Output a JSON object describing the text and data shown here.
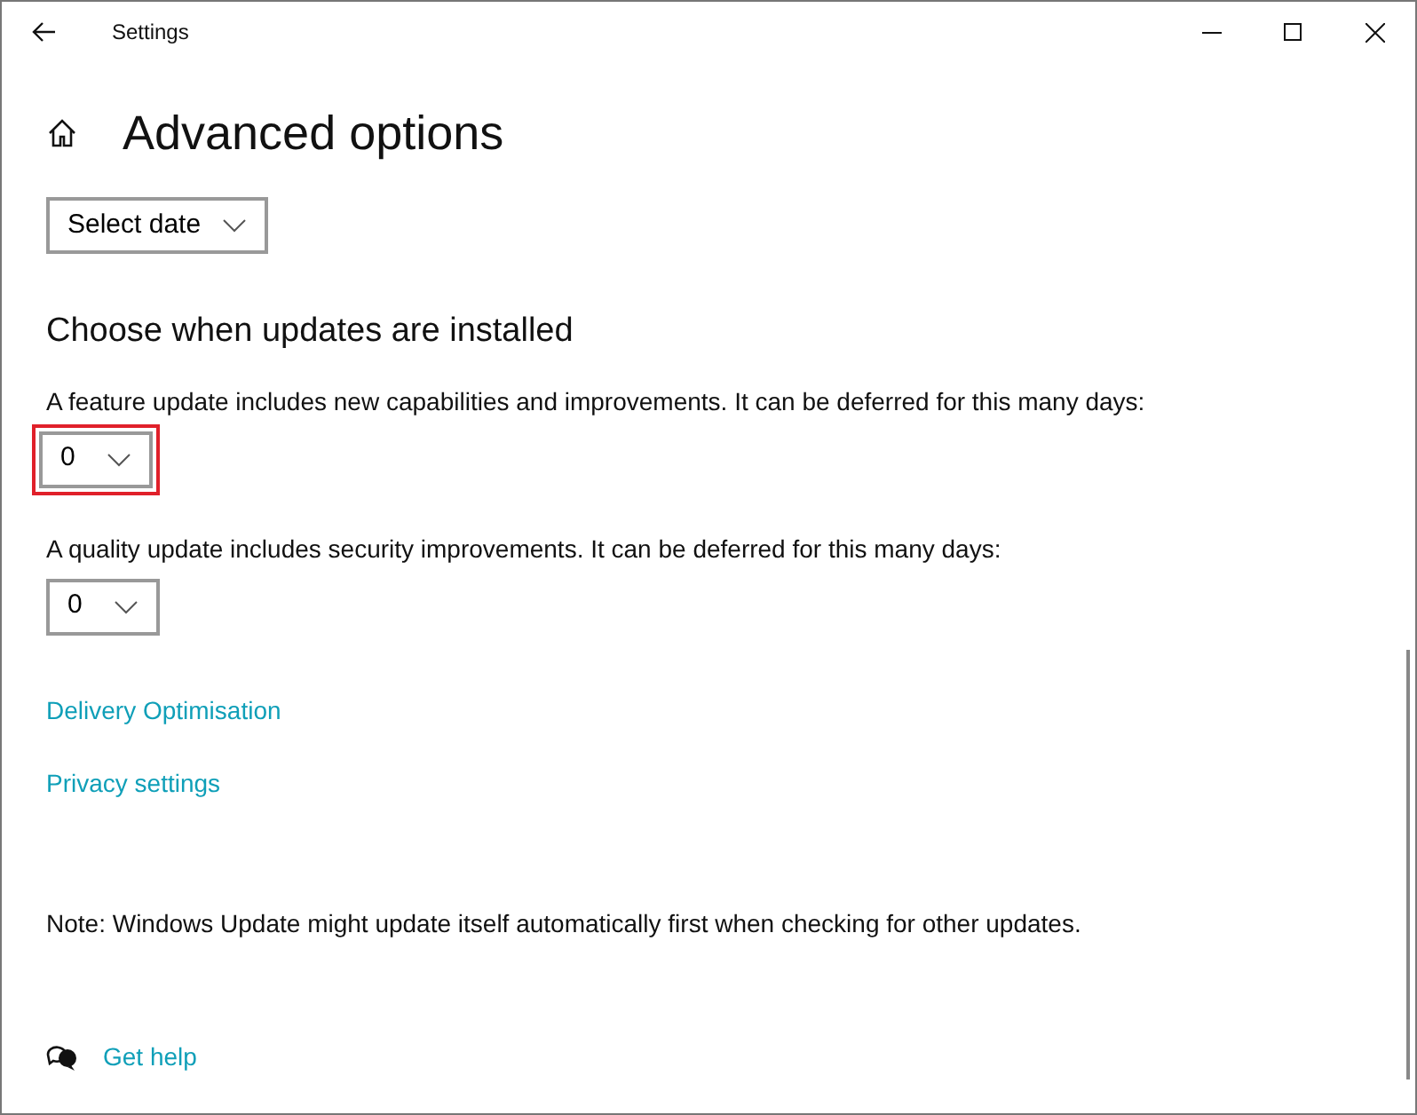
{
  "window": {
    "title": "Settings"
  },
  "page": {
    "title": "Advanced options"
  },
  "pause": {
    "value": "Select date"
  },
  "section": {
    "title": "Choose when updates are installed"
  },
  "deferrals": [
    {
      "label": "A feature update includes new capabilities and improvements. It can be deferred for this many days:",
      "value": "0",
      "highlighted": true
    },
    {
      "label": "A quality update includes security improvements. It can be deferred for this many days:",
      "value": "0",
      "highlighted": false
    }
  ],
  "links": [
    "Delivery Optimisation",
    "Privacy settings"
  ],
  "note": "Note: Windows Update might update itself automatically first when checking for other updates.",
  "help": {
    "label": "Get help"
  }
}
